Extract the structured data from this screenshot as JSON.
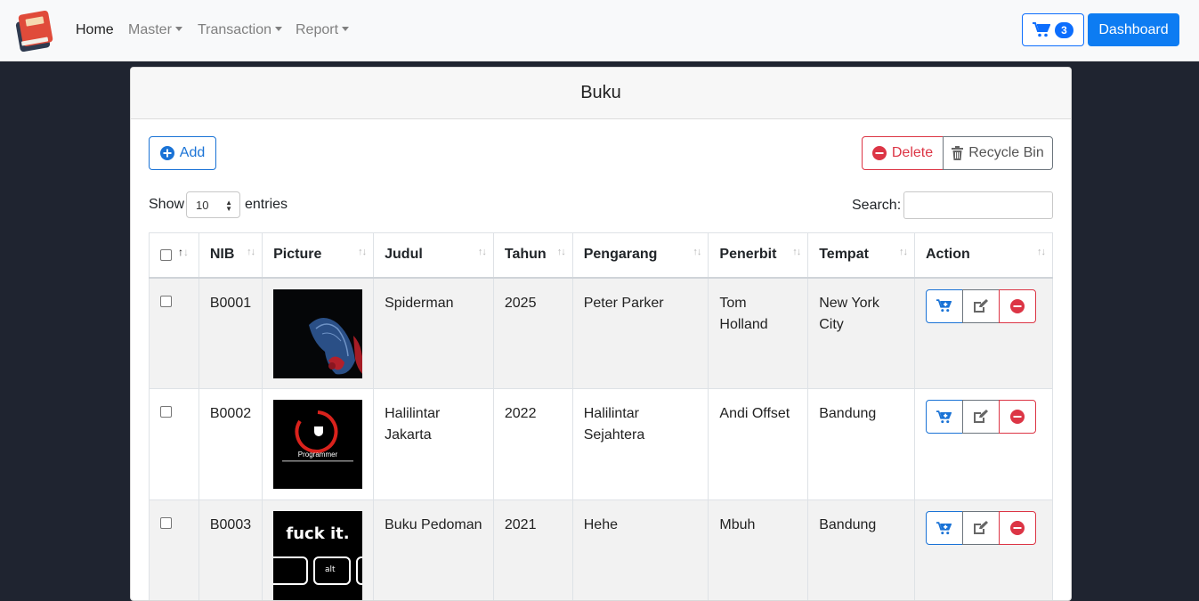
{
  "navbar": {
    "links": [
      {
        "label": "Home",
        "active": true,
        "dropdown": false
      },
      {
        "label": "Master",
        "active": false,
        "dropdown": true
      },
      {
        "label": "Transaction",
        "active": false,
        "dropdown": true
      },
      {
        "label": "Report",
        "active": false,
        "dropdown": true
      }
    ],
    "cart_count": "3",
    "dashboard_label": "Dashboard"
  },
  "card": {
    "title": "Buku",
    "add_label": "Add",
    "delete_label": "Delete",
    "recycle_label": "Recycle Bin",
    "show_label": "Show",
    "show_value": "10",
    "entries_label": "entries",
    "search_label": "Search:",
    "search_value": ""
  },
  "table": {
    "columns": [
      "NIB",
      "Picture",
      "Judul",
      "Tahun",
      "Pengarang",
      "Penerbit",
      "Tempat",
      "Action"
    ],
    "rows": [
      {
        "nib": "B0001",
        "picture": "spiderman-cover",
        "judul": "Spiderman",
        "tahun": "2025",
        "pengarang": "Peter Parker",
        "penerbit": "Tom Holland",
        "tempat": "New York City"
      },
      {
        "nib": "B0002",
        "picture": "programmer-cover",
        "judul": "Halilintar Jakarta",
        "tahun": "2022",
        "pengarang": "Halilintar Sejahtera",
        "penerbit": "Andi Offset",
        "tempat": "Bandung"
      },
      {
        "nib": "B0003",
        "picture": "keyboard-cover",
        "judul": "Buku Pedoman",
        "tahun": "2021",
        "pengarang": "Hehe",
        "penerbit": "Mbuh",
        "tempat": "Bandung"
      }
    ]
  },
  "pictures": {
    "programmer_text": "Programmer",
    "keyboard_text": "fuck it.",
    "keyboard_key": "alt"
  },
  "colors": {
    "primary": "#0d6efd",
    "danger": "#dc3545",
    "secondary": "#6c757d",
    "page_bg": "#1f2430"
  }
}
